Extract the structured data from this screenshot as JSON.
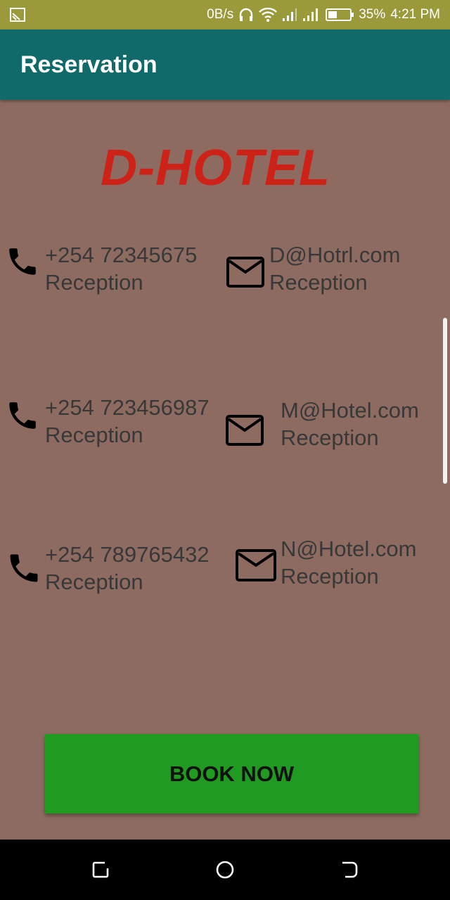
{
  "status_bar": {
    "network_speed": "0B/s",
    "battery": "35%",
    "time": "4:21 PM"
  },
  "app_bar": {
    "title": "Reservation"
  },
  "hotel_name": "D-HOTEL",
  "contacts": [
    {
      "phone": "+254 72345675",
      "phone_label": "Reception",
      "email": "D@Hotrl.com",
      "email_label": "Reception"
    },
    {
      "phone": "+254 723456987",
      "phone_label": "Reception",
      "email": "M@Hotel.com",
      "email_label": "Reception"
    },
    {
      "phone": "+254 789765432",
      "phone_label": "Reception",
      "email": "N@Hotel.com",
      "email_label": "Reception"
    }
  ],
  "book_button": {
    "label": "BOOK NOW"
  },
  "icons": {
    "phone": "phone-icon",
    "email": "mail-icon"
  },
  "colors": {
    "status_bar": "#9a9a3a",
    "app_bar": "#106a6a",
    "background": "#8d6b61",
    "hotel_name": "#cc2218",
    "button": "#219a21"
  }
}
